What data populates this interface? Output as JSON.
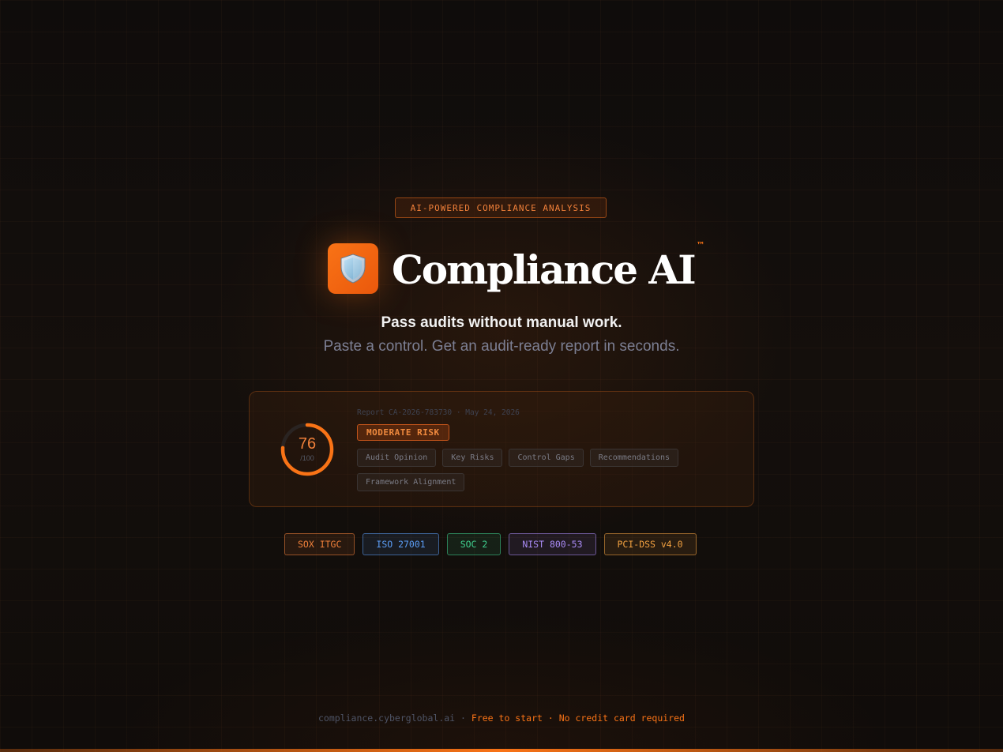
{
  "tagline": "AI-POWERED COMPLIANCE ANALYSIS",
  "brand": {
    "name": "Compliance AI",
    "trademark": "™",
    "logo_icon": "shield-icon"
  },
  "headline": "Pass audits without manual work.",
  "subheadline": "Paste a control. Get an audit-ready report in seconds.",
  "report_card": {
    "meta": "Report CA-2026-783730 · May 24, 2026",
    "score": "76",
    "score_max": "/100",
    "score_fraction": 0.76,
    "risk_level": "MODERATE RISK",
    "sections": [
      "Audit Opinion",
      "Key Risks",
      "Control Gaps",
      "Recommendations",
      "Framework Alignment"
    ]
  },
  "frameworks": [
    {
      "label": "SOX ITGC",
      "color": "#f0803a"
    },
    {
      "label": "ISO 27001",
      "color": "#5b9df5"
    },
    {
      "label": "SOC 2",
      "color": "#3fcf8e"
    },
    {
      "label": "NIST 800-53",
      "color": "#a98bf5"
    },
    {
      "label": "PCI-DSS v4.0",
      "color": "#f0a040"
    }
  ],
  "footer": {
    "domain": "compliance.cyberglobal.ai",
    "separator": "·",
    "free": "Free to start",
    "no_card": "No credit card required"
  },
  "colors": {
    "accent": "#f97316",
    "background": "#110d0b"
  }
}
